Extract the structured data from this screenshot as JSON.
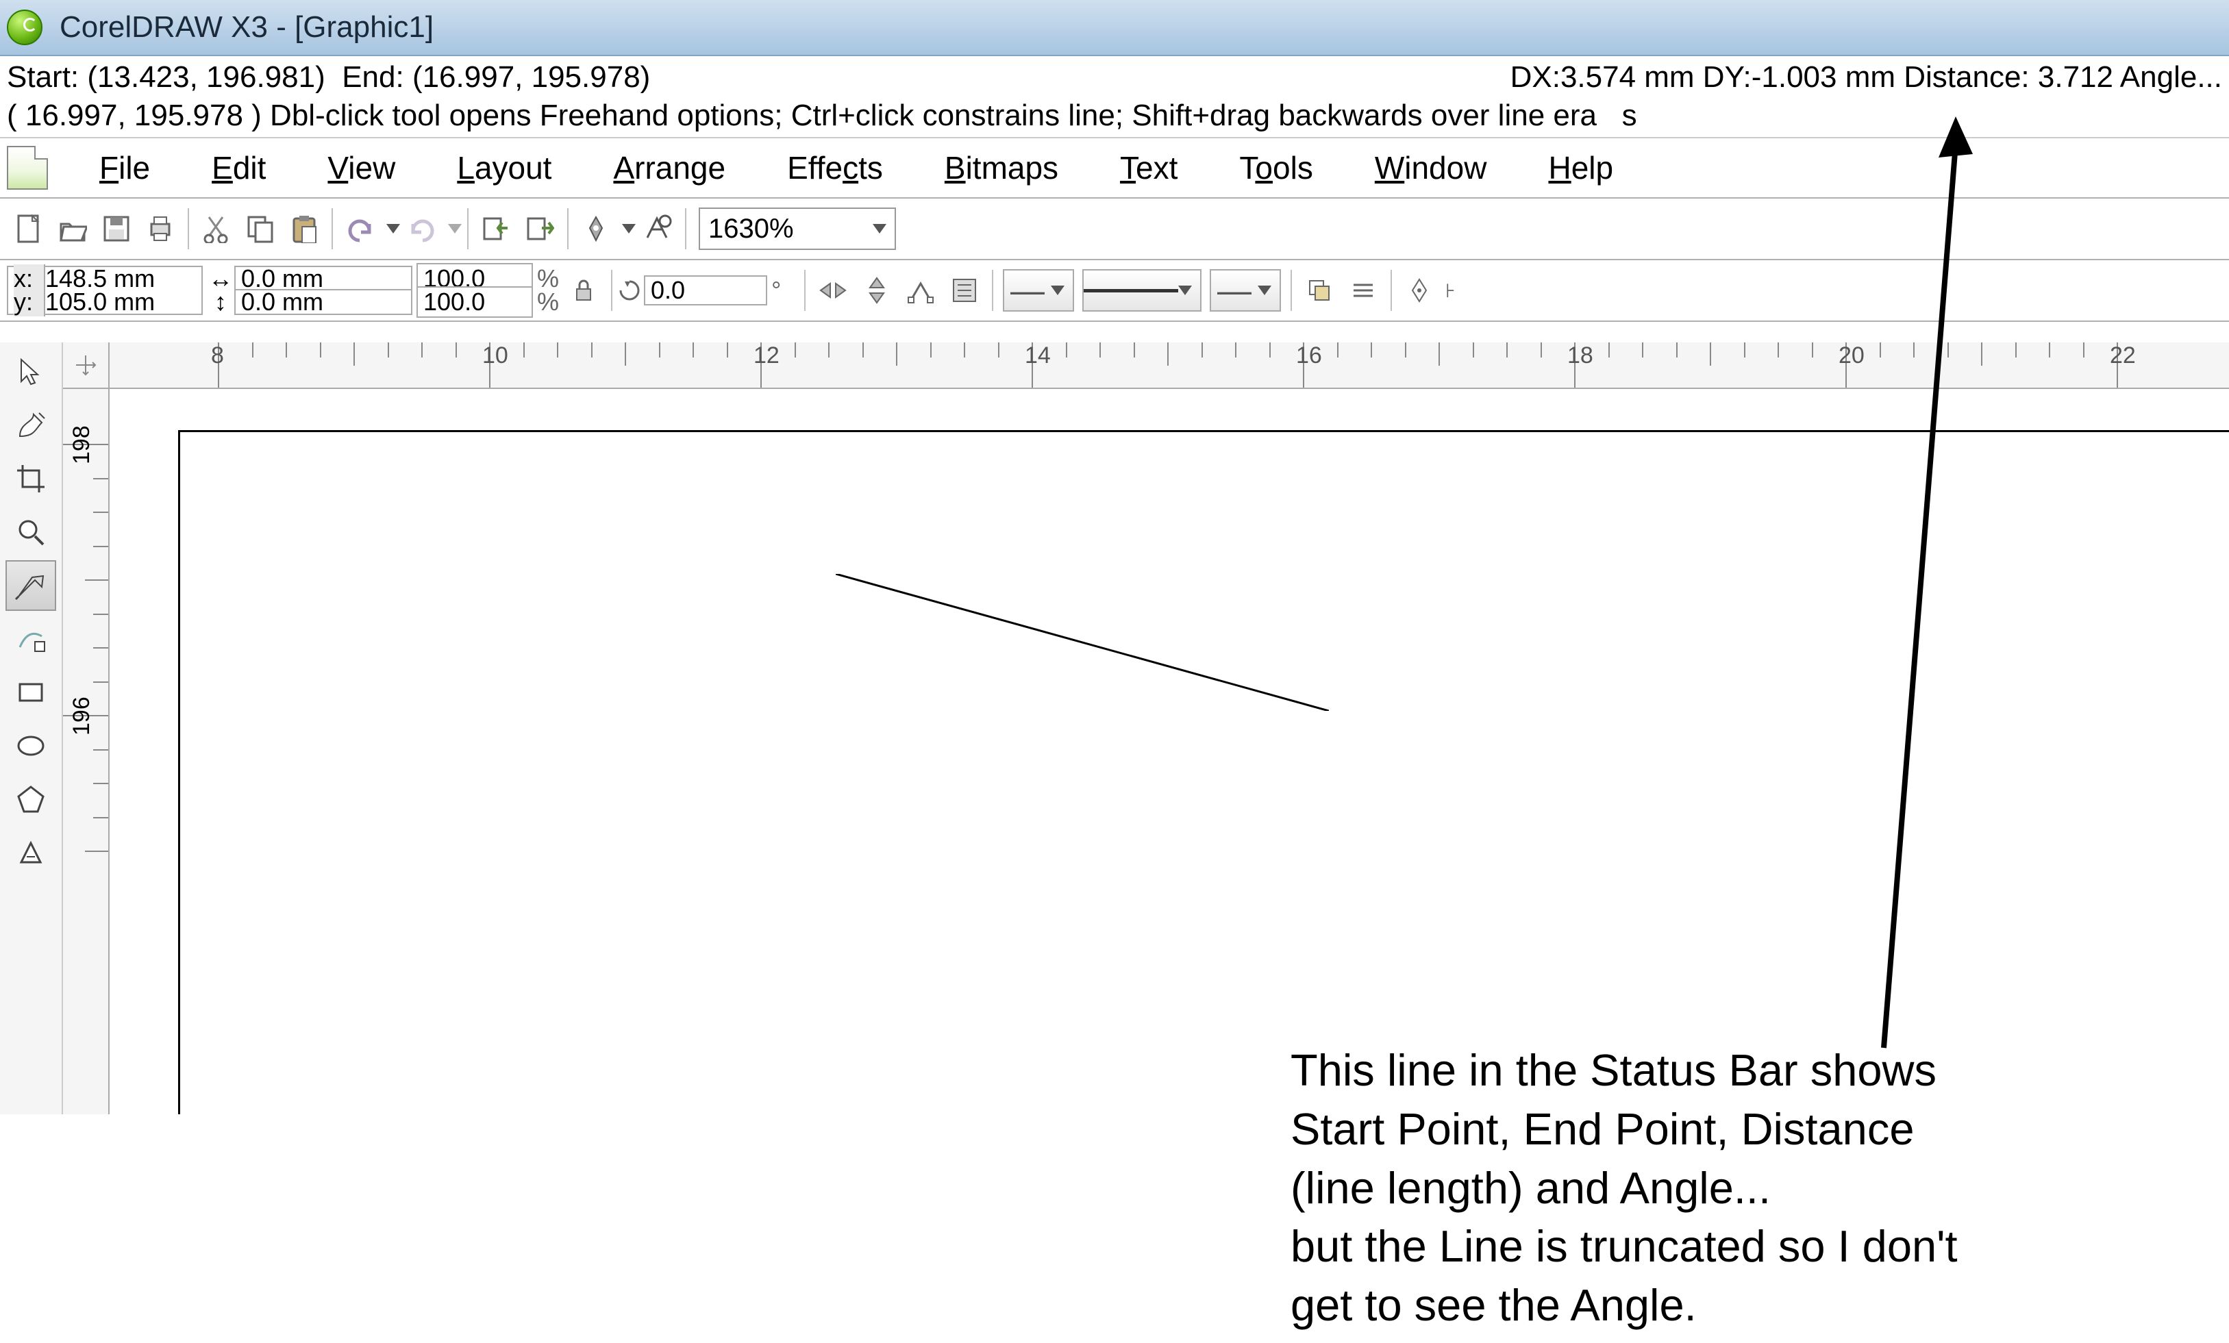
{
  "app": {
    "title": "CorelDRAW X3 - [Graphic1]"
  },
  "status": {
    "line1_left": "Start: (13.423, 196.981)  End: (16.997, 195.978)",
    "line1_right": "DX:3.574 mm DY:-1.003 mm Distance: 3.712 Angle...",
    "line2": "( 16.997, 195.978 ) Dbl-click tool opens Freehand options; Ctrl+click constrains line; Shift+drag backwards over line era   s"
  },
  "menus": {
    "file": "File",
    "edit": "Edit",
    "view": "View",
    "layout": "Layout",
    "arrange": "Arrange",
    "effects": "Effects",
    "bitmaps": "Bitmaps",
    "text": "Text",
    "tools": "Tools",
    "window": "Window",
    "help": "Help"
  },
  "toolbar": {
    "zoom": "1630%"
  },
  "props": {
    "x": "148.5 mm",
    "y": "105.0 mm",
    "w": "0.0 mm",
    "h": "0.0 mm",
    "sx": "100.0",
    "sy": "100.0",
    "rot": "0.0"
  },
  "ruler": {
    "h_labels": [
      "8",
      "10",
      "12",
      "14",
      "16",
      "18",
      "20",
      "22"
    ],
    "v_labels": [
      "198",
      "196"
    ]
  },
  "annotation": {
    "l1": "This line in the Status Bar shows",
    "l2": "Start Point, End Point, Distance",
    "l3": "(line length) and Angle...",
    "l4": "but the Line is truncated so I don't",
    "l5": "get to see the Angle."
  }
}
